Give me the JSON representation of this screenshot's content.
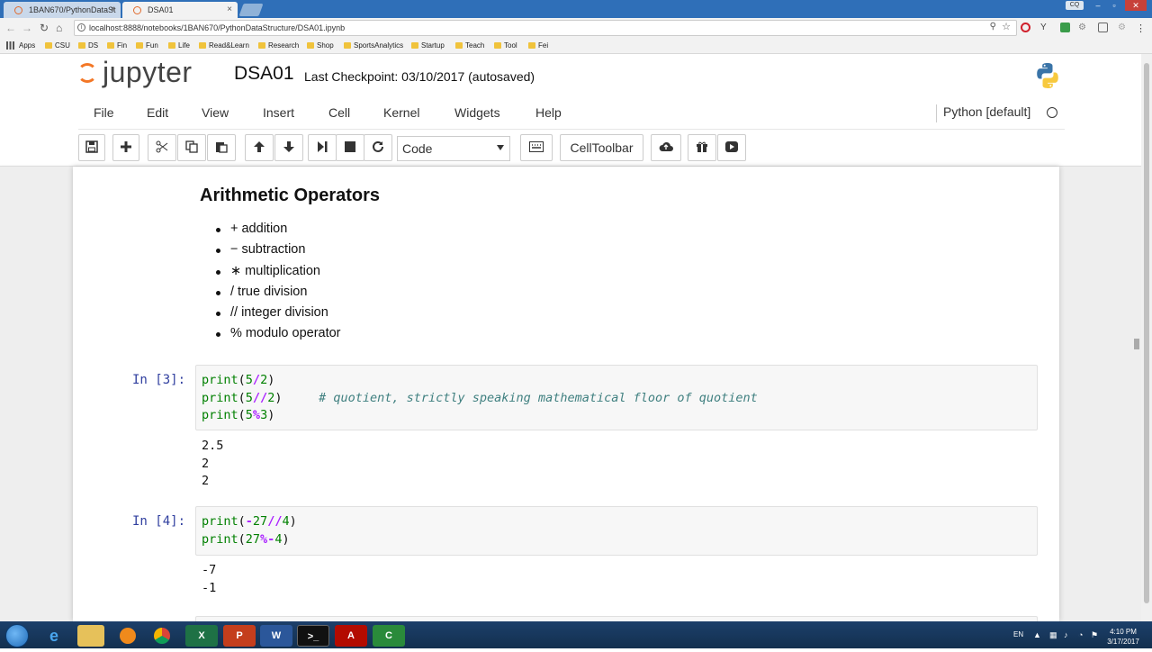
{
  "browser": {
    "tabs": [
      {
        "title": "1BAN670/PythonDataSt",
        "active": false
      },
      {
        "title": "DSA01",
        "active": true
      }
    ],
    "url": "localhost:8888/notebooks/1BAN670/PythonDataStructure/DSA01.ipynb",
    "profile_badge": "CQ",
    "bookmarks": [
      "Apps",
      "CSU",
      "DS",
      "Fin",
      "Fun",
      "Life",
      "Read&Learn",
      "Research",
      "Shop",
      "SportsAnalytics",
      "Startup",
      "Teach",
      "Tool",
      "Fei"
    ]
  },
  "jupyter": {
    "logo_text": "jupyter",
    "notebook_name": "DSA01",
    "checkpoint": "Last Checkpoint: 03/10/2017 (autosaved)",
    "menus": [
      "File",
      "Edit",
      "View",
      "Insert",
      "Cell",
      "Kernel",
      "Widgets",
      "Help"
    ],
    "kernel_name": "Python [default]",
    "toolbar": {
      "cell_type": "Code",
      "celltoolbar_label": "CellToolbar"
    }
  },
  "notebook": {
    "markdown_heading": "Arithmetic Operators",
    "operators": [
      "+ addition",
      "− subtraction",
      "∗ multiplication",
      "/ true division",
      "// integer division",
      "% modulo operator"
    ],
    "cells": [
      {
        "prompt": "In [3]:",
        "outputs": [
          "2.5",
          "2",
          "2"
        ]
      },
      {
        "prompt": "In [4]:",
        "outputs": [
          "-7",
          "-1"
        ]
      }
    ],
    "comment": "# quotient, strictly speaking mathematical floor of quotient"
  },
  "taskbar": {
    "lang": "EN",
    "time": "4:10 PM",
    "date": "3/17/2017"
  },
  "colors": {
    "tabbar": "#2f6fb8",
    "jupyter_orange": "#f37726",
    "prompt_blue": "#303f9f",
    "keyword_green": "#008000",
    "operator_purple": "#aa22ff",
    "comment_teal": "#408080"
  }
}
